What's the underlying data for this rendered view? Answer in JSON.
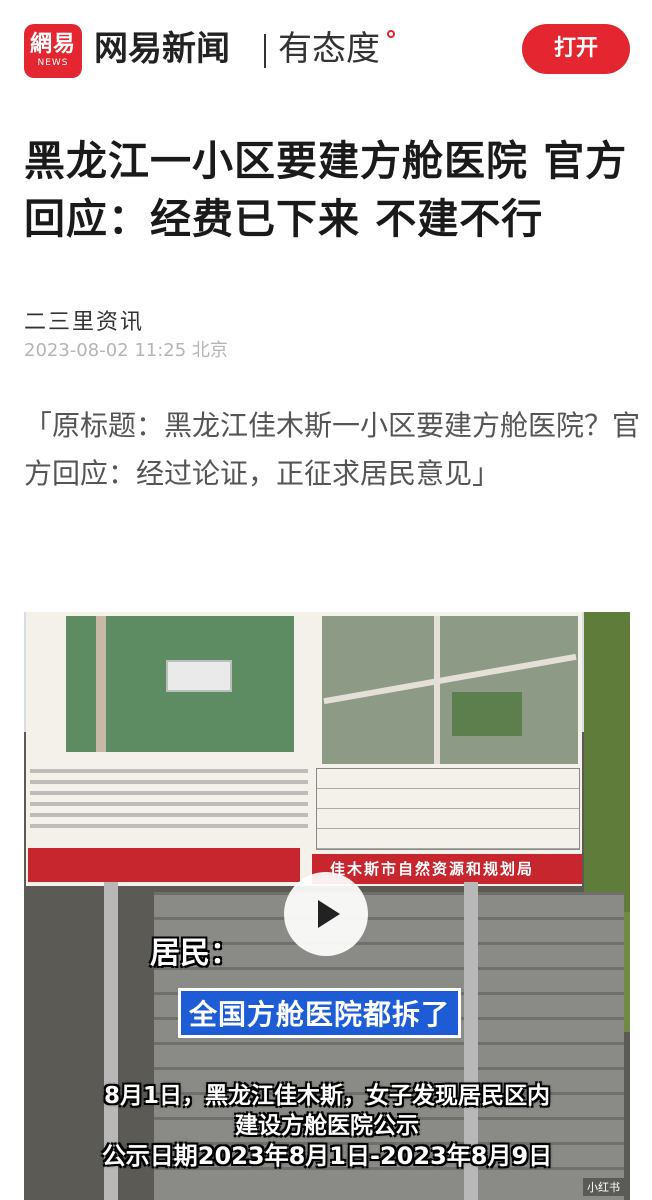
{
  "header": {
    "logo_text": "網易",
    "logo_sub": "NEWS",
    "brand": "网易新闻",
    "slogan": "有态度",
    "open_button": "打开",
    "accent_color": "#e3262f"
  },
  "article": {
    "title": "黑龙江一小区要建方舱医院 官方回应：经费已下来 不建不行",
    "source": "二三里资讯",
    "date": "2023-08-02 11:25 北京",
    "quote": "「原标题：黑龙江佳木斯一小区要建方舱医院？官方回应：经过论证，正征求居民意见」"
  },
  "video": {
    "bureau_sign": "佳木斯市自然资源和规划局",
    "caption_speaker": "居民：",
    "caption_banner": "全国方舱医院都拆了",
    "caption_line1": "8月1日，黑龙江佳木斯，女子发现居民区内",
    "caption_line2": "建设方舱医院公示",
    "caption_line3": "公示日期2023年8月1日-2023年8月9日",
    "watermark": "小红书",
    "play_icon": "play-icon"
  }
}
